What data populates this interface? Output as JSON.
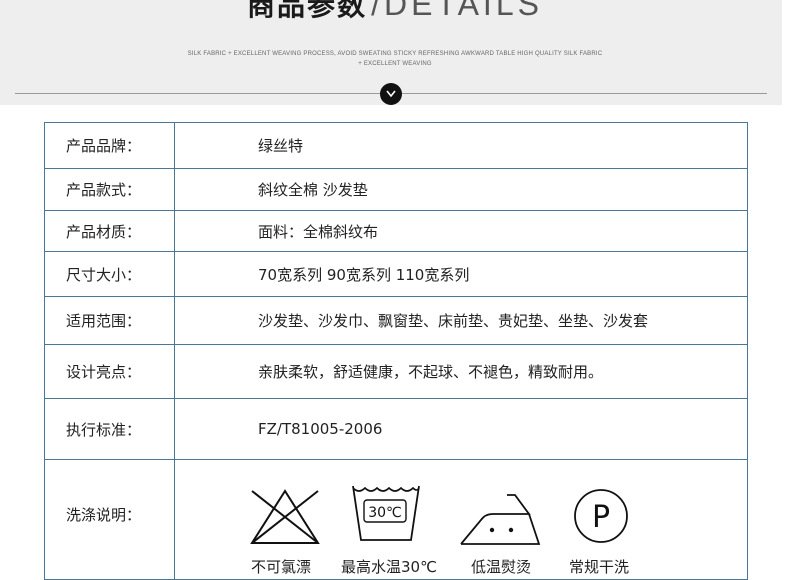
{
  "header": {
    "title_cn": "商品参数",
    "title_en": "/DETAILS",
    "tagline": "SILK FABRIC + EXCELLENT WEAVING PROCESS, AVOID SWEATING STICKY REFRESHING AWKWARD TABLE HIGH QUALITY SILK FABRIC + EXCELLENT WEAVING"
  },
  "rows": [
    {
      "label": "产品品牌：",
      "value": "绿丝特"
    },
    {
      "label": "产品款式：",
      "value": "斜纹全棉 沙发垫"
    },
    {
      "label": "产品材质：",
      "value": "面料：全棉斜纹布"
    },
    {
      "label": "尺寸大小：",
      "value": "70宽系列 90宽系列 110宽系列"
    },
    {
      "label": "适用范围：",
      "value": "沙发垫、沙发巾、飘窗垫、床前垫、贵妃垫、坐垫、沙发套"
    },
    {
      "label": "设计亮点：",
      "value": "亲肤柔软，舒适健康，不起球、不褪色，精致耐用。"
    },
    {
      "label": "执行标准：",
      "value": "FZ/T81005-2006"
    }
  ],
  "care": {
    "label": "洗涤说明：",
    "icons": [
      {
        "icon": "no-bleach-icon",
        "text": "不可氯漂"
      },
      {
        "icon": "wash-30-icon",
        "text": "最高水温30℃",
        "symbol_text": "30℃"
      },
      {
        "icon": "low-iron-icon",
        "text": "低温熨烫"
      },
      {
        "icon": "dry-clean-icon",
        "text": "常规干洗",
        "symbol_text": "P"
      }
    ]
  }
}
